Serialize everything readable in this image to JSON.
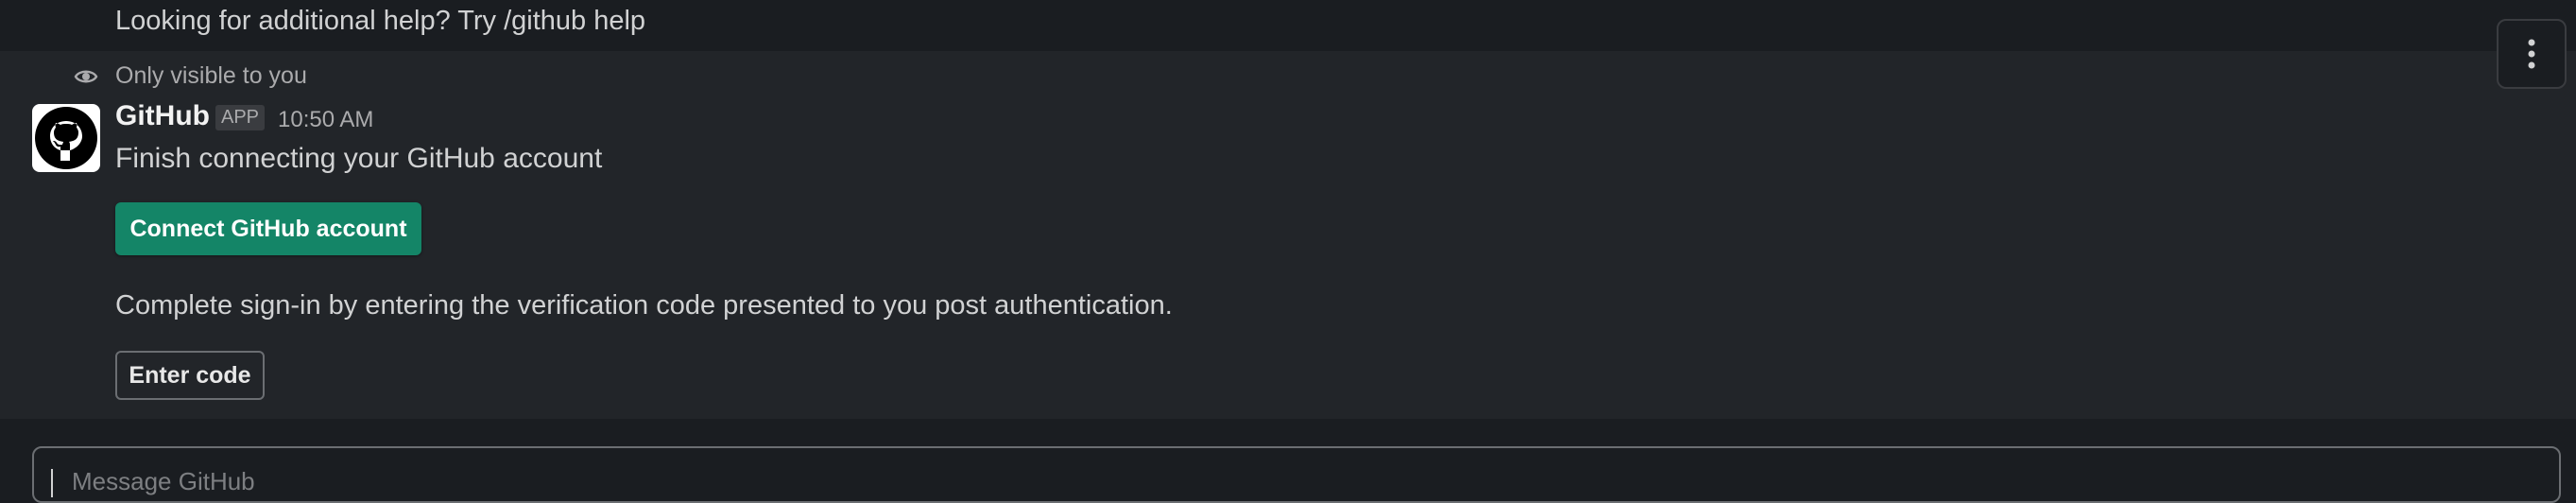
{
  "top_message": {
    "text": "Looking for additional help? Try /github help"
  },
  "ephemeral": {
    "visibility_text": "Only visible to you",
    "icon": "eye-icon"
  },
  "message": {
    "sender": "GitHub",
    "badge": "APP",
    "timestamp": "10:50 AM",
    "avatar_icon": "github-octocat-icon",
    "text": "Finish connecting your GitHub account",
    "connect_button_label": "Connect GitHub account",
    "instruction_text": "Complete sign-in by entering the verification code presented to you post authentication.",
    "enter_code_button_label": "Enter code"
  },
  "actions": {
    "more_icon": "more-vertical-icon"
  },
  "composer": {
    "placeholder": "Message GitHub"
  },
  "colors": {
    "background": "#1a1d21",
    "message_highlight": "#222529",
    "primary_button": "#148567",
    "text": "#d1d2d3",
    "muted_text": "#ababad"
  }
}
